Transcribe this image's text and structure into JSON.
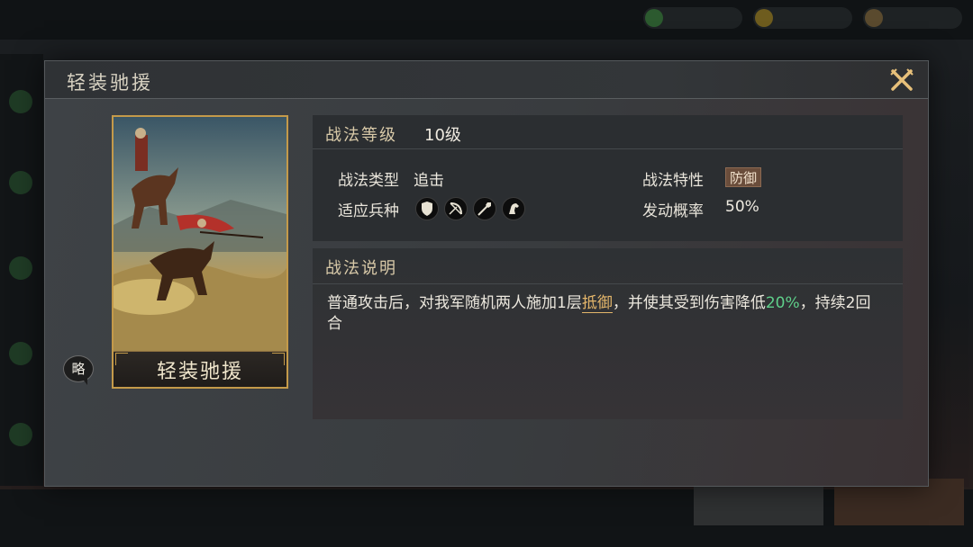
{
  "dialog": {
    "title": "轻装驰援"
  },
  "card": {
    "name": "轻装驰援",
    "strategy_badge": "略"
  },
  "tactic": {
    "level_label": "战法等级",
    "level_value": "10级",
    "type_label": "战法类型",
    "type_value": "追击",
    "troops_label": "适应兵种",
    "troops": [
      "shield-unit-icon",
      "bow-unit-icon",
      "spear-unit-icon",
      "cavalry-unit-icon"
    ],
    "trait_label": "战法特性",
    "trait_value": "防御",
    "rate_label": "发动概率",
    "rate_value": "50%"
  },
  "description": {
    "header": "战法说明",
    "part1": "普通攻击后，对我军随机两人施加1层",
    "keyword": "抵御",
    "part2": "，并使其受到伤害降低",
    "percent": "20%",
    "part3": "，持续2回合"
  },
  "colors": {
    "card_border": "#c49a4a",
    "keyword": "#e4b66a",
    "percent": "#5fd08a",
    "trait_tag": "#6a4d3b"
  }
}
